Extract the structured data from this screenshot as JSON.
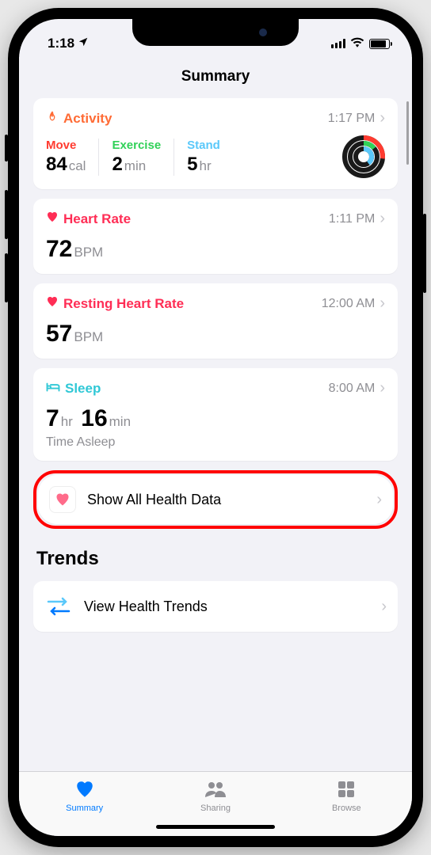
{
  "status": {
    "time": "1:18"
  },
  "header": {
    "title": "Summary"
  },
  "activity": {
    "title": "Activity",
    "time": "1:17 PM",
    "move_label": "Move",
    "move_value": "84",
    "move_unit": "cal",
    "exercise_label": "Exercise",
    "exercise_value": "2",
    "exercise_unit": "min",
    "stand_label": "Stand",
    "stand_value": "5",
    "stand_unit": "hr"
  },
  "heart_rate": {
    "title": "Heart Rate",
    "time": "1:11 PM",
    "value": "72",
    "unit": "BPM"
  },
  "resting_hr": {
    "title": "Resting Heart Rate",
    "time": "12:00 AM",
    "value": "57",
    "unit": "BPM"
  },
  "sleep": {
    "title": "Sleep",
    "time": "8:00 AM",
    "hours": "7",
    "hours_unit": "hr",
    "mins": "16",
    "mins_unit": "min",
    "sub": "Time Asleep"
  },
  "show_all": {
    "label": "Show All Health Data"
  },
  "trends": {
    "section": "Trends",
    "view_label": "View Health Trends"
  },
  "tabs": {
    "summary": "Summary",
    "sharing": "Sharing",
    "browse": "Browse"
  }
}
